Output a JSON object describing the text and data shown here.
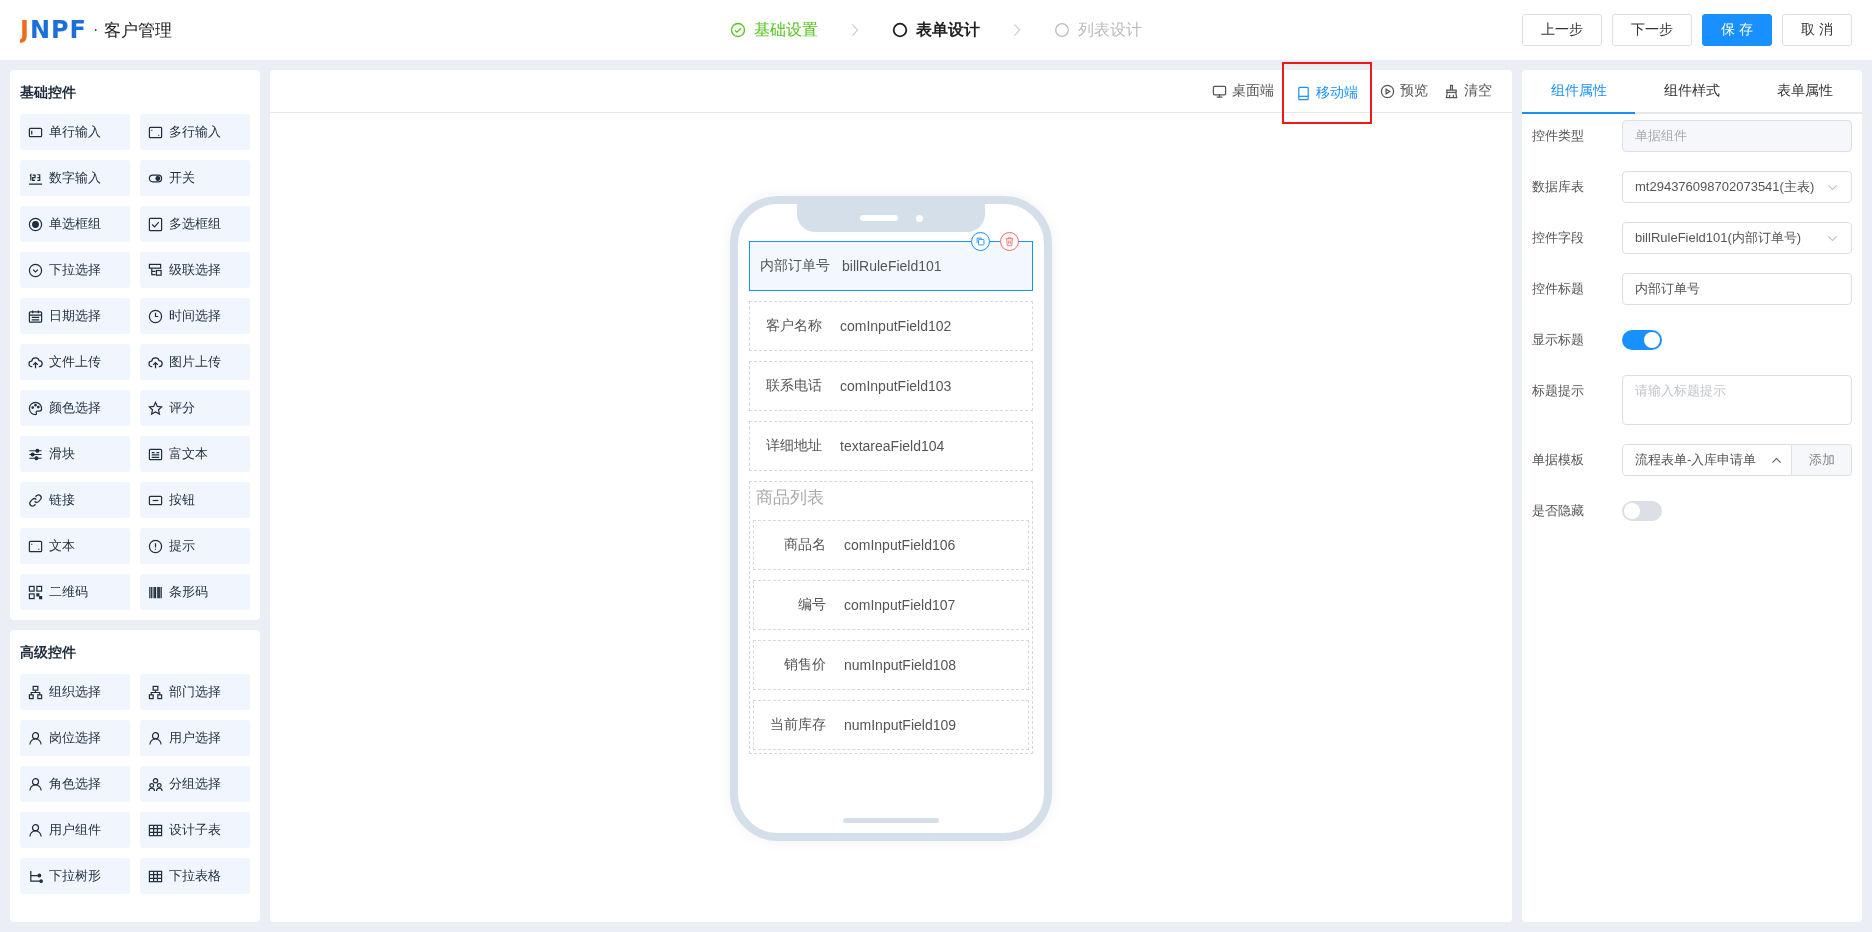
{
  "header": {
    "logo": "JNPF",
    "separator": "·",
    "title": "客户管理",
    "steps": [
      {
        "label": "基础设置",
        "completed": true,
        "selected": false
      },
      {
        "label": "表单设计",
        "completed": false,
        "selected": true
      },
      {
        "label": "列表设计",
        "completed": false,
        "selected": false
      }
    ],
    "buttons": [
      {
        "label": "上一步",
        "primary": false
      },
      {
        "label": "下一步",
        "primary": false
      },
      {
        "label": "保 存",
        "primary": true
      },
      {
        "label": "取 消",
        "primary": false
      }
    ]
  },
  "widget_groups": [
    {
      "title": "基础控件",
      "items": [
        {
          "label": "单行输入",
          "kind": "input"
        },
        {
          "label": "多行输入",
          "kind": "textarea"
        },
        {
          "label": "数字输入",
          "kind": "number"
        },
        {
          "label": "开关",
          "kind": "switch"
        },
        {
          "label": "单选框组",
          "kind": "radio"
        },
        {
          "label": "多选框组",
          "kind": "checkbox"
        },
        {
          "label": "下拉选择",
          "kind": "select"
        },
        {
          "label": "级联选择",
          "kind": "cascader"
        },
        {
          "label": "日期选择",
          "kind": "date"
        },
        {
          "label": "时间选择",
          "kind": "time"
        },
        {
          "label": "文件上传",
          "kind": "upload"
        },
        {
          "label": "图片上传",
          "kind": "upload"
        },
        {
          "label": "颜色选择",
          "kind": "color"
        },
        {
          "label": "评分",
          "kind": "rate"
        },
        {
          "label": "滑块",
          "kind": "slider"
        },
        {
          "label": "富文本",
          "kind": "editor"
        },
        {
          "label": "链接",
          "kind": "link"
        },
        {
          "label": "按钮",
          "kind": "button"
        },
        {
          "label": "文本",
          "kind": "textarea"
        },
        {
          "label": "提示",
          "kind": "alert"
        },
        {
          "label": "二维码",
          "kind": "qrcode"
        },
        {
          "label": "条形码",
          "kind": "barcode"
        }
      ]
    },
    {
      "title": "高级控件",
      "items": [
        {
          "label": "组织选择",
          "kind": "org"
        },
        {
          "label": "部门选择",
          "kind": "org"
        },
        {
          "label": "岗位选择",
          "kind": "user"
        },
        {
          "label": "用户选择",
          "kind": "user"
        },
        {
          "label": "角色选择",
          "kind": "user"
        },
        {
          "label": "分组选择",
          "kind": "group"
        },
        {
          "label": "用户组件",
          "kind": "user"
        },
        {
          "label": "设计子表",
          "kind": "table"
        },
        {
          "label": "下拉树形",
          "kind": "tree"
        },
        {
          "label": "下拉表格",
          "kind": "table"
        }
      ]
    }
  ],
  "toolbar": [
    {
      "label": "桌面端",
      "kind": "desktop",
      "selected": false,
      "highlighted": false
    },
    {
      "label": "移动端",
      "kind": "mobile",
      "selected": true,
      "highlighted": true
    },
    {
      "label": "预览",
      "kind": "preview",
      "selected": false,
      "highlighted": false
    },
    {
      "label": "清空",
      "kind": "clear",
      "selected": false,
      "highlighted": false
    }
  ],
  "phone": {
    "fields": [
      {
        "label": "内部订单号",
        "value": "billRuleField101",
        "selected": true
      },
      {
        "label": "客户名称",
        "value": "comInputField102",
        "selected": false
      },
      {
        "label": "联系电话",
        "value": "comInputField103",
        "selected": false
      },
      {
        "label": "详细地址",
        "value": "textareaField104",
        "selected": false
      }
    ],
    "table": {
      "title": "商品列表",
      "fields": [
        {
          "label": "商品名",
          "value": "comInputField106"
        },
        {
          "label": "编号",
          "value": "comInputField107"
        },
        {
          "label": "销售价",
          "value": "numInputField108"
        },
        {
          "label": "当前库存",
          "value": "numInputField109"
        }
      ]
    }
  },
  "properties": {
    "tabs": [
      {
        "label": "组件属性",
        "selected": true
      },
      {
        "label": "组件样式",
        "selected": false
      },
      {
        "label": "表单属性",
        "selected": false
      }
    ],
    "rows": [
      {
        "label": "控件类型",
        "kind": "input",
        "value": "单据组件",
        "disabled": true
      },
      {
        "label": "数据库表",
        "kind": "select",
        "value": "mt294376098702073541(主表)"
      },
      {
        "label": "控件字段",
        "kind": "select",
        "value": "billRuleField101(内部订单号)"
      },
      {
        "label": "控件标题",
        "kind": "input",
        "value": "内部订单号",
        "disabled": false
      },
      {
        "label": "显示标题",
        "kind": "switch",
        "on": true
      },
      {
        "label": "标题提示",
        "kind": "textarea",
        "placeholder": "请输入标题提示"
      },
      {
        "label": "单据模板",
        "kind": "template",
        "value": "流程表单-入库申请单",
        "expanded": true,
        "button": "添加"
      },
      {
        "label": "是否隐藏",
        "kind": "switch",
        "on": false
      }
    ]
  }
}
